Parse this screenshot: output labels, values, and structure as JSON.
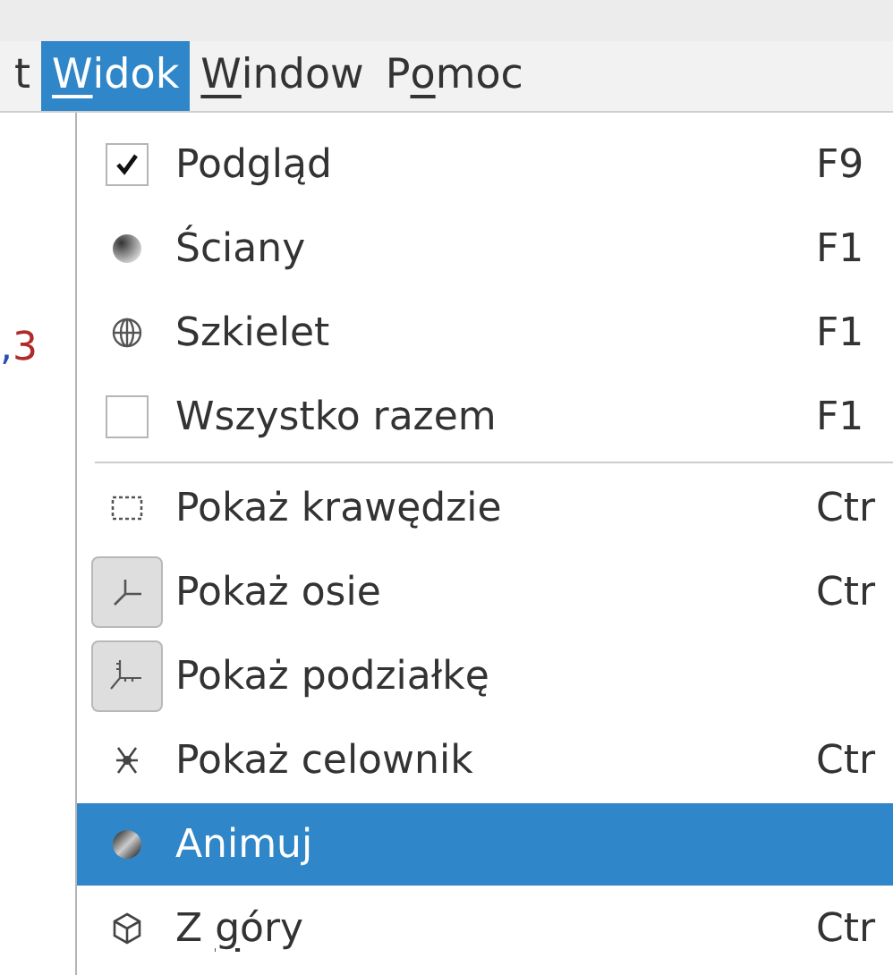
{
  "menubar": [
    {
      "post": "t",
      "selected": false
    },
    {
      "key": "W",
      "post": "idok",
      "selected": true
    },
    {
      "key": "W",
      "post": "indow",
      "selected": false
    },
    {
      "pre": "P",
      "key": "o",
      "post": "moc",
      "selected": false
    }
  ],
  "editor_fragment": [
    {
      "text": ",",
      "color": "#2a4fb0"
    },
    {
      "text": "3",
      "color": "#b02a2a"
    }
  ],
  "menu": [
    {
      "kind": "check",
      "checked": true,
      "label": "Podgląd",
      "shortcut": "F9",
      "selected": false
    },
    {
      "kind": "icon",
      "label": "Ściany",
      "shortcut": "F1",
      "selected": false
    },
    {
      "kind": "icon",
      "label": "Szkielet",
      "shortcut": "F1",
      "selected": false
    },
    {
      "kind": "check",
      "checked": false,
      "label": "Wszystko razem",
      "shortcut": "F1",
      "selected": false
    },
    {
      "kind": "separator"
    },
    {
      "kind": "icon",
      "label": "Pokaż krawędzie",
      "shortcut": "Ctr",
      "selected": false
    },
    {
      "kind": "toggle",
      "checked": true,
      "label": "Pokaż osie",
      "shortcut": "Ctr",
      "selected": false
    },
    {
      "kind": "toggle",
      "checked": true,
      "label": "Pokaż podziałkę",
      "selected": false
    },
    {
      "kind": "icon",
      "label": "Pokaż celownik",
      "shortcut": "Ctr",
      "selected": false
    },
    {
      "kind": "icon",
      "label": "Animuj",
      "selected": true
    },
    {
      "kind": "icon",
      "label_pre": "Z ",
      "label_key": "g",
      "label_post": "óry",
      "shortcut": "Ctr",
      "selected": false
    }
  ]
}
